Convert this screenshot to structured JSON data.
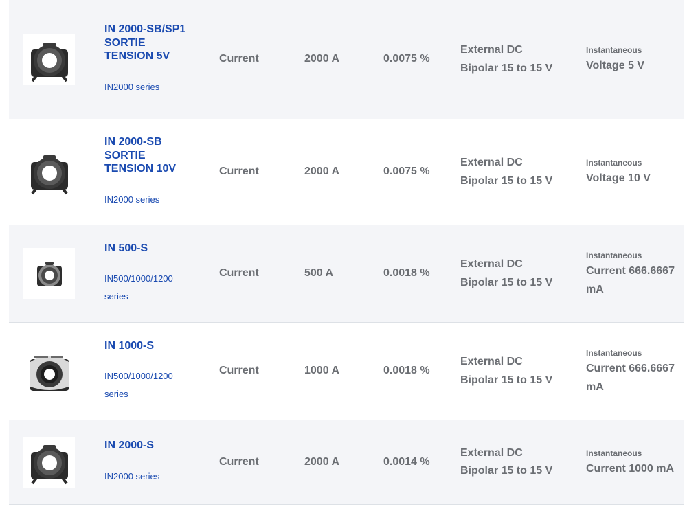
{
  "rows": [
    {
      "name": "IN 2000-SB/SP1 SORTIE TENSION 5V",
      "series": "IN2000 series",
      "type": "Current",
      "range": "2000 A",
      "accuracy": "0.0075 %",
      "supply": "External DC Bipolar 15 to 15 V",
      "output_label": "Instantaneous",
      "output_value": "Voltage 5 V",
      "icon": "sensor-ring-icon"
    },
    {
      "name": "IN 2000-SB SORTIE TENSION 10V",
      "series": "IN2000 series",
      "type": "Current",
      "range": "2000 A",
      "accuracy": "0.0075 %",
      "supply": "External DC Bipolar 15 to 15 V",
      "output_label": "Instantaneous",
      "output_value": "Voltage 10 V",
      "icon": "sensor-ring-icon"
    },
    {
      "name": "IN 500-S",
      "series": "IN500/1000/1200 series",
      "type": "Current",
      "range": "500 A",
      "accuracy": "0.0018 %",
      "supply": "External DC Bipolar 15 to 15 V",
      "output_label": "Instantaneous",
      "output_value": "Current 666.6667 mA",
      "icon": "sensor-ring-small-icon"
    },
    {
      "name": "IN 1000-S",
      "series": "IN500/1000/1200 series",
      "type": "Current",
      "range": "1000 A",
      "accuracy": "0.0018 %",
      "supply": "External DC Bipolar 15 to 15 V",
      "output_label": "Instantaneous",
      "output_value": "Current 666.6667 mA",
      "icon": "sensor-ring-labeled-icon"
    },
    {
      "name": "IN 2000-S",
      "series": "IN2000 series",
      "type": "Current",
      "range": "2000 A",
      "accuracy": "0.0014 %",
      "supply": "External DC Bipolar 15 to 15 V",
      "output_label": "Instantaneous",
      "output_value": "Current 1000 mA",
      "icon": "sensor-ring-icon"
    }
  ],
  "colors": {
    "link": "#1a4ab0",
    "text": "#6b6e73",
    "row_alt_bg": "#f4f5f8",
    "divider": "#dde1e6"
  }
}
